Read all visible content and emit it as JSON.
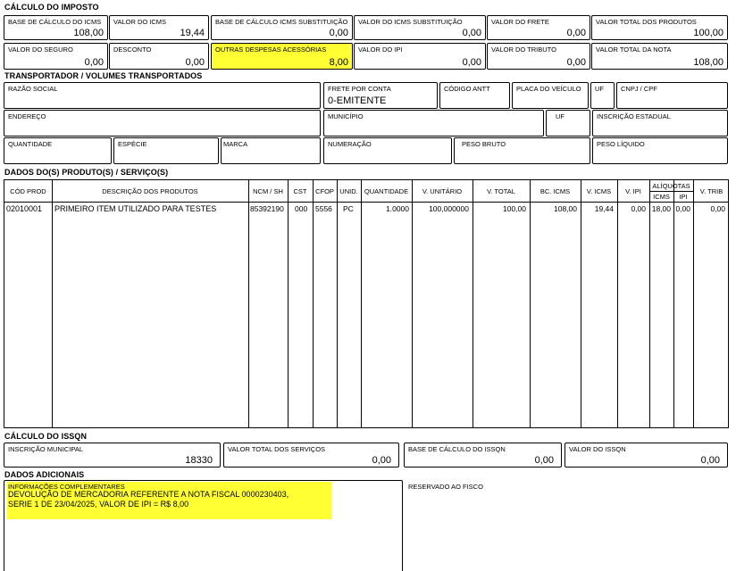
{
  "imposto": {
    "title": "CÁLCULO DO IMPOSTO",
    "base_icms": {
      "label": "BASE DE CÁLCULO DO ICMS",
      "value": "108,00"
    },
    "valor_icms": {
      "label": "VALOR DO ICMS",
      "value": "19,44"
    },
    "base_icms_st": {
      "label": "BASE DE CÁLCULO ICMS SUBSTITUIÇÃO",
      "value": "0,00"
    },
    "valor_icms_st": {
      "label": "VALOR DO ICMS SUBSTITUIÇÃO",
      "value": "0,00"
    },
    "valor_frete": {
      "label": "VALOR DO FRETE",
      "value": "0,00"
    },
    "valor_total_produtos": {
      "label": "VALOR TOTAL DOS PRODUTOS",
      "value": "100,00"
    },
    "valor_seguro": {
      "label": "VALOR DO SEGURO",
      "value": "0,00"
    },
    "desconto": {
      "label": "DESCONTO",
      "value": "0,00"
    },
    "outras_despesas": {
      "label": "OUTRAS DESPESAS ACESSÓRIAS",
      "value": "8,00"
    },
    "valor_ipi": {
      "label": "VALOR DO IPI",
      "value": "0,00"
    },
    "valor_tributo": {
      "label": "VALOR DO TRIBUTO",
      "value": "0,00"
    },
    "valor_total_nota": {
      "label": "VALOR TOTAL DA NOTA",
      "value": "108,00"
    }
  },
  "transportador": {
    "title": "TRANSPORTADOR / VOLUMES TRANSPORTADOS",
    "razao_social": {
      "label": "RAZÃO SOCIAL",
      "value": ""
    },
    "frete_por_conta": {
      "label": "FRETE POR CONTA",
      "value": "0-EMITENTE"
    },
    "codigo_antt": {
      "label": "CÓDIGO ANTT",
      "value": ""
    },
    "placa_veiculo": {
      "label": "PLACA DO VEÍCULO",
      "value": ""
    },
    "uf1": {
      "label": "UF",
      "value": ""
    },
    "cnpj_cpf": {
      "label": "CNPJ / CPF",
      "value": ""
    },
    "endereco": {
      "label": "ENDEREÇO",
      "value": ""
    },
    "municipio": {
      "label": "MUNICÍPIO",
      "value": ""
    },
    "uf2": {
      "label": "UF",
      "value": ""
    },
    "inscricao_estadual": {
      "label": "INSCRIÇÃO ESTADUAL",
      "value": ""
    },
    "quantidade": {
      "label": "QUANTIDADE",
      "value": ""
    },
    "especie": {
      "label": "ESPÉCIE",
      "value": ""
    },
    "marca": {
      "label": "MARCA",
      "value": ""
    },
    "numeracao": {
      "label": "NUMERAÇÃO",
      "value": ""
    },
    "peso_bruto": {
      "label": "PESO BRUTO",
      "value": ""
    },
    "peso_liquido": {
      "label": "PESO LÍQUIDO",
      "value": ""
    }
  },
  "produtos": {
    "title": "DADOS DO(S) PRODUTO(S) / SERVIÇO(S)",
    "headers": {
      "cod_prod": "CÓD PROD",
      "descricao": "DESCRIÇÃO DOS PRODUTOS",
      "ncm": "NCM / SH",
      "cst": "CST",
      "cfop": "CFOP",
      "unid": "UNID.",
      "quantidade": "QUANTIDADE",
      "v_unitario": "V. UNITÁRIO",
      "v_total": "V. TOTAL",
      "bc_icms": "BC. ICMS",
      "v_icms": "V. ICMS",
      "v_ipi": "V. IPI",
      "aliquotas": "ALÍQUOTAS",
      "aliq_icms": "ICMS",
      "aliq_ipi": "IPI",
      "v_trib": "V. TRIB"
    },
    "rows": [
      {
        "cod_prod": "02010001",
        "descricao": "PRIMEIRO ITEM UTILIZADO PARA TESTES",
        "ncm": "85392190",
        "cst": "000",
        "cfop": "5556",
        "unid": "PC",
        "quantidade": "1.0000",
        "v_unitario": "100,000000",
        "v_total": "100,00",
        "bc_icms": "108,00",
        "v_icms": "19,44",
        "v_ipi": "0,00",
        "aliq_icms": "18,00",
        "aliq_ipi": "0,00",
        "v_trib": "0,00"
      }
    ]
  },
  "issqn": {
    "title": "CÁLCULO DO ISSQN",
    "inscricao_municipal": {
      "label": "INSCRIÇÃO MUNICIPAL",
      "value": "18330"
    },
    "valor_total_servicos": {
      "label": "VALOR TOTAL DOS SERVIÇOS",
      "value": "0,00"
    },
    "base_issqn": {
      "label": "BASE DE CÁLCULO DO ISSQN",
      "value": "0,00"
    },
    "valor_issqn": {
      "label": "VALOR DO ISSQN",
      "value": "0,00"
    }
  },
  "adicionais": {
    "title": "DADOS ADICIONAIS",
    "info_label": "INFORMAÇÕES COMPLEMENTARES",
    "info_line1": "DEVOLUÇÃO DE MERCADORIA REFERENTE A NOTA FISCAL  0000230403,",
    "info_line2": "SERIE  1 DE 23/04/2025, VALOR DE IPI = R$ 8,00",
    "reservado_label": "RESERVADO AO FISCO"
  },
  "colors": {
    "highlight": "#ffff33"
  }
}
